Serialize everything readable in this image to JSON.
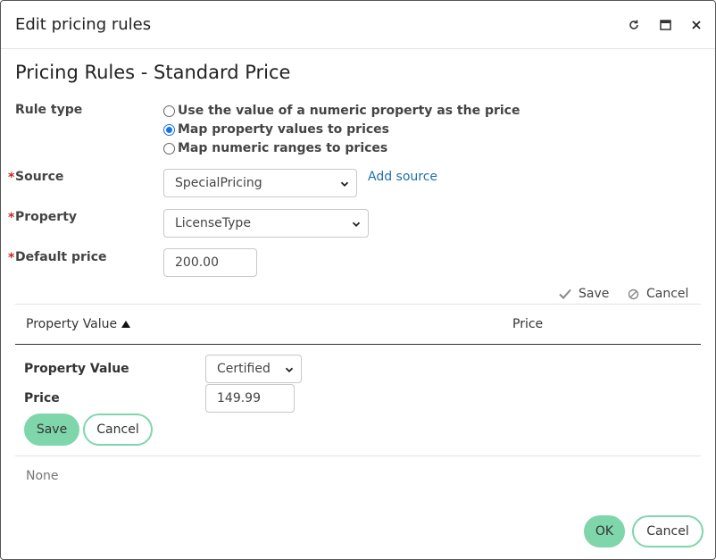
{
  "window": {
    "title": "Edit pricing rules",
    "controls": [
      "refresh-icon",
      "maximize-icon",
      "close-icon"
    ]
  },
  "form": {
    "heading": "Pricing Rules - Standard Price",
    "rule_type": {
      "label": "Rule type",
      "options": [
        {
          "label": "Use the value of a numeric property as the price",
          "checked": false
        },
        {
          "label": "Map property values to prices",
          "checked": true
        },
        {
          "label": "Map numeric ranges to prices",
          "checked": false
        }
      ]
    },
    "source": {
      "label": "Source",
      "required_mark": "*",
      "value": "SpecialPricing",
      "add_link": "Add source"
    },
    "property": {
      "label": "Property",
      "required_mark": "*",
      "value": "LicenseType"
    },
    "default_price": {
      "label": "Default price",
      "required_mark": "*",
      "value": "200.00"
    }
  },
  "table_actions": {
    "save": "Save",
    "cancel": "Cancel"
  },
  "table": {
    "columns": [
      {
        "label": "Property Value",
        "sort": "asc"
      },
      {
        "label": "Price"
      }
    ],
    "editor": {
      "property_value_label": "Property Value",
      "property_value": "Certified",
      "price_label": "Price",
      "price_value": "149.99",
      "save": "Save",
      "cancel": "Cancel"
    },
    "empty_text": "None"
  },
  "footer": {
    "ok": "OK",
    "cancel": "Cancel"
  },
  "colors": {
    "accent": "#7fd6ab",
    "link": "#1f6fa8",
    "required": "#c62828",
    "radio": "#1a73e8"
  }
}
